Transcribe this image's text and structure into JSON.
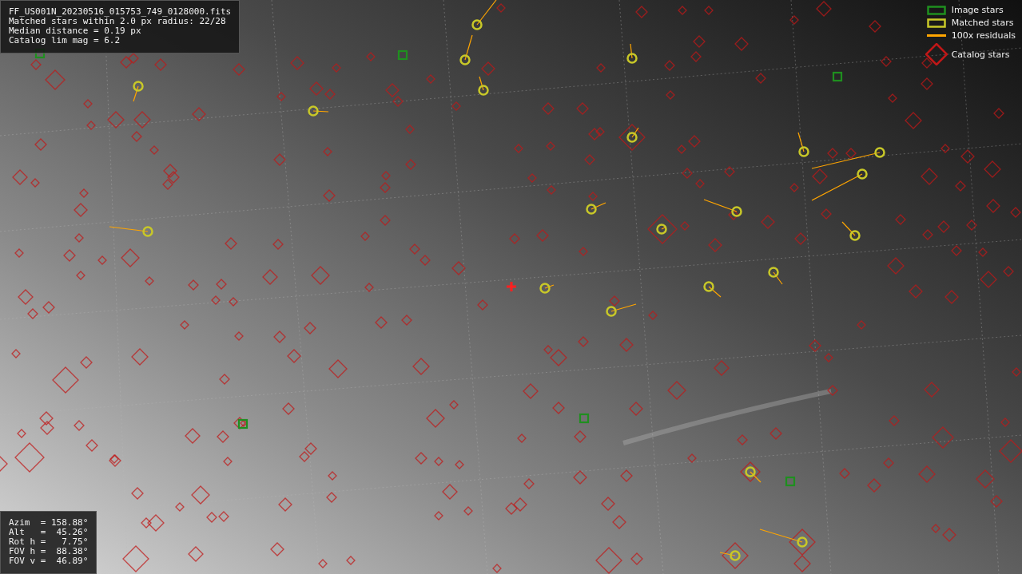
{
  "info_panel": {
    "lines": [
      "FF_US001N_20230516_015753_749_0128000.fits",
      "Matched stars within 2.0 px radius: 22/28",
      "Median distance = 0.19 px",
      "Catalog lim mag = 6.2"
    ]
  },
  "legend": [
    {
      "kind": "box",
      "label": "Image stars",
      "color": "#1f8f1f"
    },
    {
      "kind": "box",
      "label": "Matched stars",
      "color": "#c8c828"
    },
    {
      "kind": "line",
      "label": "100x residuals",
      "color": "#ffa500"
    },
    {
      "kind": "diamond",
      "label": "Catalog stars",
      "color": "#c01818"
    }
  ],
  "pointing_panel": {
    "lines": [
      "Azim  = 158.88°",
      "Alt   =  45.26°",
      "Rot h =   7.75°",
      "FOV h =  88.38°",
      "FOV v =  46.89°"
    ]
  }
}
